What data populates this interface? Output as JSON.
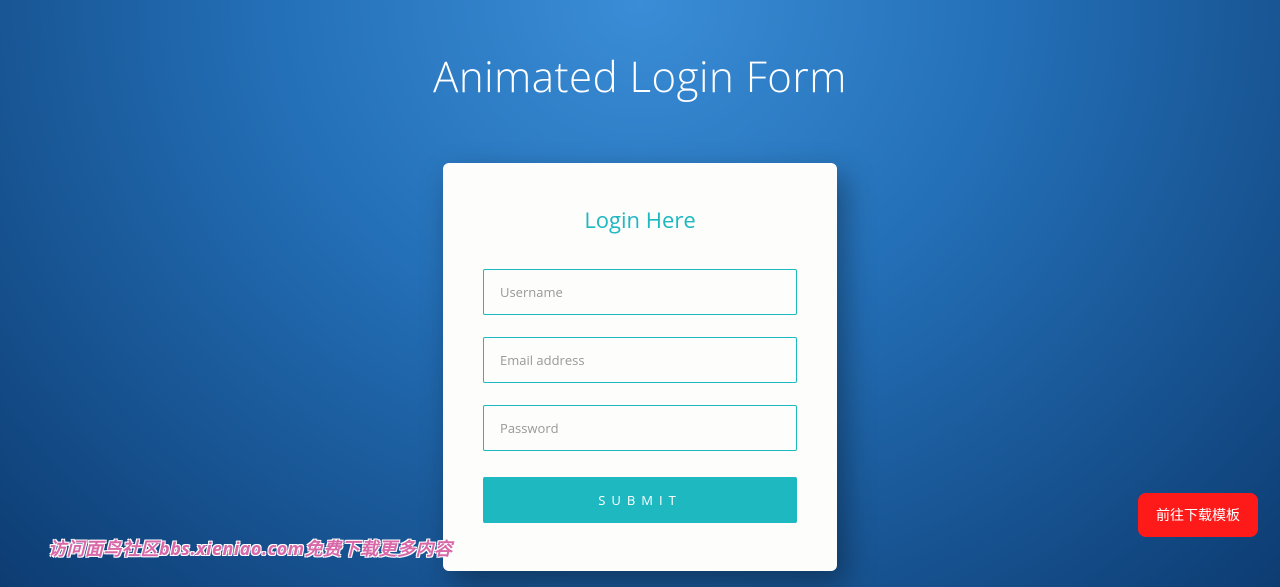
{
  "page": {
    "title": "Animated Login Form"
  },
  "card": {
    "title": "Login Here"
  },
  "form": {
    "username": {
      "placeholder": "Username",
      "value": ""
    },
    "email": {
      "placeholder": "Email address",
      "value": ""
    },
    "password": {
      "placeholder": "Password",
      "value": ""
    },
    "submit_label": "SUBMIT"
  },
  "download_button": {
    "label": "前往下载模板"
  },
  "watermark": {
    "text": "访问面鸟社区bbs.xieniao.com免费下载更多内容"
  }
}
